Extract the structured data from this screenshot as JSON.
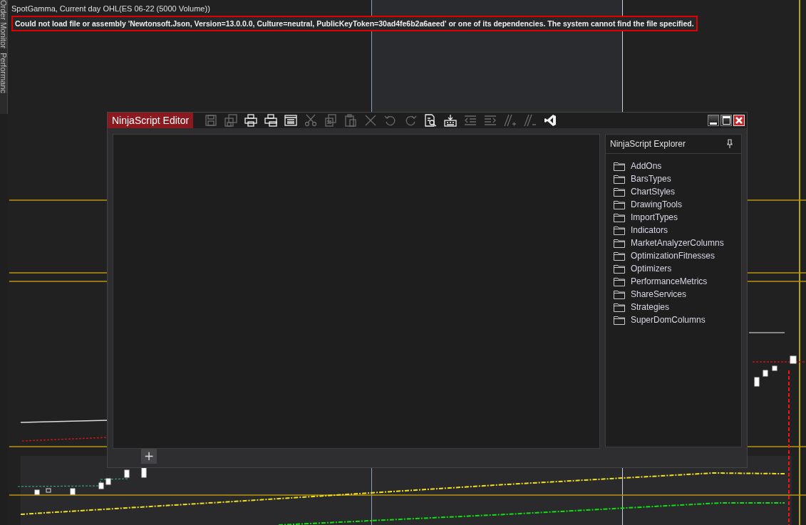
{
  "side_tabs": [
    {
      "label": "Order Monitor"
    },
    {
      "label": "Performanc"
    }
  ],
  "chart": {
    "title": "SpotGamma, Current day OHL(ES 06-22 (5000 Volume))",
    "error": "Could not load file or assembly 'Newtonsoft.Json, Version=13.0.0.0, Culture=neutral, PublicKeyToken=30ad4fe6b2a6aeed' or one of its dependencies. The system cannot find the file specified."
  },
  "editor": {
    "title": "NinjaScript Editor",
    "toolbar": [
      {
        "kind": "save",
        "disabled": true
      },
      {
        "kind": "save-all",
        "disabled": true
      },
      {
        "kind": "print",
        "disabled": false
      },
      {
        "kind": "print-preview",
        "disabled": false
      },
      {
        "kind": "window",
        "disabled": false
      },
      {
        "kind": "cut",
        "disabled": true
      },
      {
        "kind": "copy",
        "disabled": true
      },
      {
        "kind": "paste",
        "disabled": true
      },
      {
        "kind": "delete",
        "disabled": true
      },
      {
        "kind": "undo",
        "disabled": true
      },
      {
        "kind": "redo",
        "disabled": true
      },
      {
        "kind": "find",
        "disabled": false
      },
      {
        "kind": "compile",
        "disabled": false
      },
      {
        "kind": "outdent",
        "disabled": true
      },
      {
        "kind": "indent",
        "disabled": true
      },
      {
        "kind": "comment",
        "disabled": true
      },
      {
        "kind": "uncomment",
        "disabled": true
      },
      {
        "kind": "visual-studio",
        "disabled": false
      }
    ],
    "add_tab": "+",
    "explorer": {
      "title": "NinjaScript Explorer",
      "items": [
        {
          "label": "AddOns"
        },
        {
          "label": "BarsTypes"
        },
        {
          "label": "ChartStyles"
        },
        {
          "label": "DrawingTools"
        },
        {
          "label": "ImportTypes"
        },
        {
          "label": "Indicators"
        },
        {
          "label": "MarketAnalyzerColumns"
        },
        {
          "label": "OptimizationFitnesses"
        },
        {
          "label": "Optimizers"
        },
        {
          "label": "PerformanceMetrics"
        },
        {
          "label": "ShareServices"
        },
        {
          "label": "Strategies"
        },
        {
          "label": "SuperDomColumns"
        }
      ]
    }
  }
}
